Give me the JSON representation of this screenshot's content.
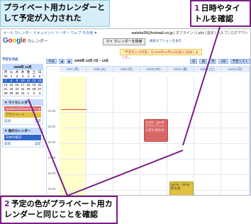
{
  "callouts": {
    "top_caption": "プライベート用カレンダーとして予定が入力された",
    "step1_num": "1",
    "step1_text": "日時やタイトルを確認",
    "step2_num": "2",
    "step2_text": "予定の色がプライベート用カレンダーと同じことを確認"
  },
  "calendar": {
    "topbar_left": "メール  カレンダー  ドキュメント  リーダー  ウェブ  その他 ▼",
    "topbar_email": "watabe28@hotmail.co.jp",
    "topbar_links": "| オフライン | Labs | 設定 | ヘルプ | ログアウト",
    "logo_letters": [
      "G",
      "o",
      "o",
      "g",
      "l",
      "e"
    ],
    "logo_suffix": "カレンダー",
    "search_button": "マイ カレンダーを検索",
    "search_options": "検索オプションを表示",
    "notice": "「予定の入力内容」を2009年12月11日(金)に追加しました。",
    "create_link": "予定を作成",
    "minical_title": "2009年 12月",
    "minical_weekdays": [
      "月",
      "火",
      "水",
      "木",
      "金",
      "土",
      "日"
    ],
    "minical_rows": [
      [
        "30",
        "1",
        "2",
        "3",
        "4",
        "5",
        "6"
      ],
      [
        "7",
        "8",
        "9",
        "10",
        "11",
        "12",
        "13"
      ],
      [
        "14",
        "15",
        "16",
        "17",
        "18",
        "19",
        "20"
      ],
      [
        "21",
        "22",
        "23",
        "24",
        "25",
        "26",
        "27"
      ],
      [
        "28",
        "29",
        "30",
        "31",
        "1",
        "2",
        "3"
      ]
    ],
    "my_calendars_title": "▼ マイカレンダー",
    "my_calendar_items": [
      {
        "label": "watabe28@hotmail.co.jp",
        "color": "#d96666"
      },
      {
        "label": "プライベート",
        "color": "#e0c240"
      }
    ],
    "my_calendars_links": [
      "追加",
      "設定"
    ],
    "other_calendars_title": "▼ 他のカレンダー",
    "other_calendar_items": [
      {
        "label": "日本の祝日",
        "color": "#3366cc"
      }
    ],
    "other_calendars_links": [
      "追加",
      "設定"
    ],
    "toolbar_today": "今日",
    "toolbar_range": "2009年 12月 7日 – 13日",
    "toolbar_tabs": [
      "日",
      "週",
      "月",
      "4日",
      "予定リスト"
    ],
    "day_headers": [
      "12/7 (月)",
      "12/8 (火)",
      "12/9 (水)",
      "12/10 (木)",
      "12/11 (金)",
      "12/12 (土)",
      "12/13 (日)"
    ],
    "hours": [
      "14:00",
      "15:00",
      "16:00",
      "17:00",
      "18:00",
      "19:00",
      "20:00"
    ],
    "events": {
      "red_title": "14:00 - 15:30",
      "red_body": "クライアントと打ち合わせ",
      "yellow_title": "19:00 - 20:00",
      "yellow_body": "飲み会"
    },
    "colors": {
      "accent": "#7a1e85",
      "private_event": "#e0c240",
      "work_event": "#d96666"
    }
  }
}
